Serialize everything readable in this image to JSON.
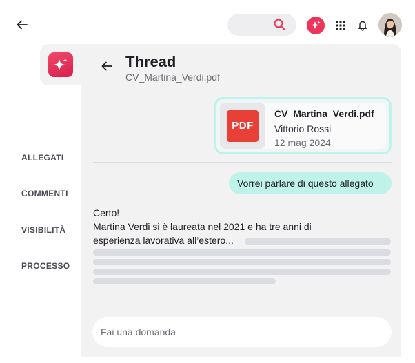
{
  "topbar": {
    "back_icon": "arrow-left-icon",
    "search_icon": "search-icon",
    "ai_icon": "sparkle-icon",
    "apps_icon": "grid-icon",
    "bell_icon": "bell-icon",
    "avatar_icon": "user-avatar"
  },
  "sidebar": {
    "logo_icon": "sparkle-icon",
    "items": [
      {
        "label": "ALLEGATI"
      },
      {
        "label": "COMMENTI"
      },
      {
        "label": "VISIBILITÀ"
      },
      {
        "label": "PROCESSO"
      }
    ]
  },
  "thread": {
    "title": "Thread",
    "subtitle": "CV_Martina_Verdi.pdf",
    "file": {
      "badge": "PDF",
      "name": "CV_Martina_Verdi.pdf",
      "author": "Vittorio Rossi",
      "date": "12 mag 2024"
    },
    "user_message": "Vorrei parlare di questo allegato",
    "reply": {
      "line1": "Certo!",
      "line2": "Martina Verdi si è laureata nel 2021 e ha tre anni di esperienza lavorativa all’estero..."
    },
    "input_placeholder": "Fai una domanda"
  },
  "colors": {
    "accent": "#ef3459",
    "bubble": "#bff2e8",
    "panel": "#f2f2f3",
    "pdf": "#e84036"
  }
}
